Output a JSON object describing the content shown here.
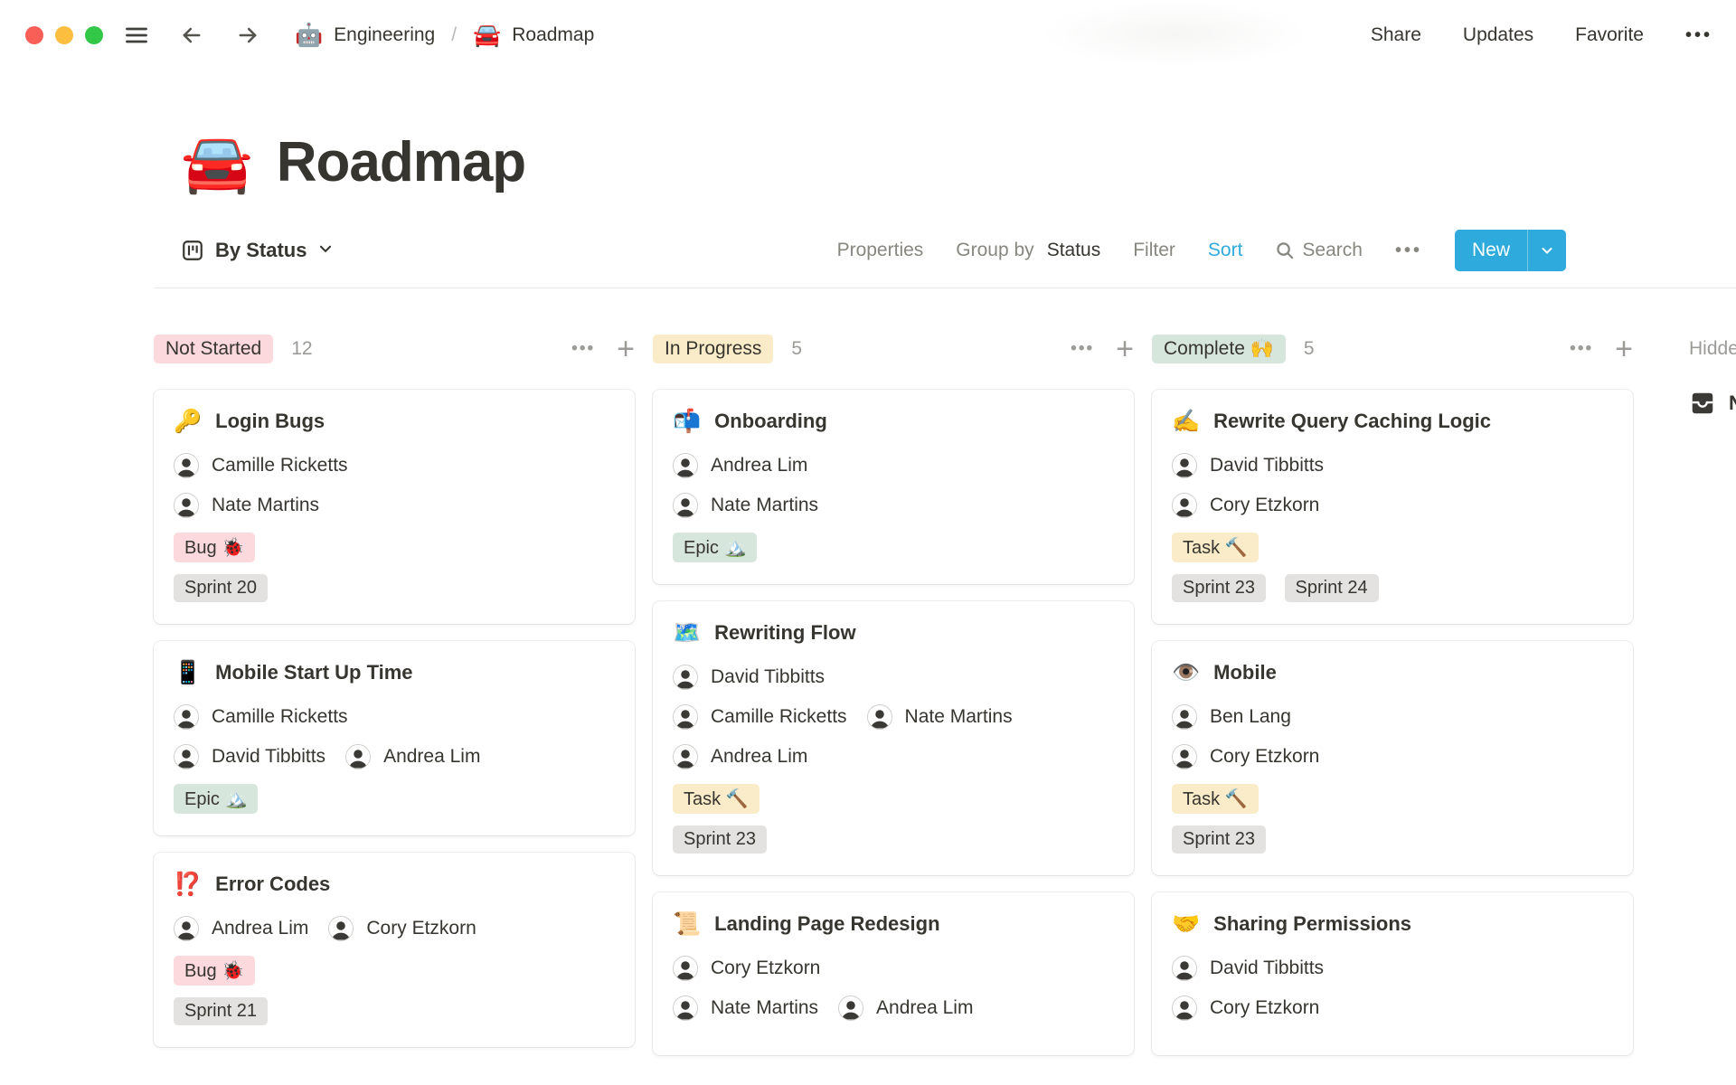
{
  "theme": {
    "accent_blue": "#2EAADC",
    "text_dark": "#37352F",
    "text_gray": "#9B9A97",
    "tag_pink": "#FBD9DC",
    "tag_yellow": "#FAEBC9",
    "tag_green": "#D7E6DD",
    "tag_gray": "#E3E2E0",
    "traffic_red": "#F95F57",
    "traffic_yellow": "#FBBE3F",
    "traffic_green": "#33C748"
  },
  "topbar": {
    "breadcrumb": {
      "space_icon": "🤖",
      "space_label": "Engineering",
      "separator": "/",
      "page_icon": "🚘",
      "page_label": "Roadmap"
    },
    "actions": {
      "share": "Share",
      "updates": "Updates",
      "favorite": "Favorite",
      "more": "•••"
    }
  },
  "page": {
    "icon": "🚘",
    "title": "Roadmap"
  },
  "toolbar": {
    "view_label": "By Status",
    "properties": "Properties",
    "group_by": "Group by",
    "group_by_value": "Status",
    "filter": "Filter",
    "sort": "Sort",
    "search": "Search",
    "more": "•••",
    "new_label": "New"
  },
  "board": {
    "hidden_label": "Hidden",
    "no_status_label": "No",
    "columns": [
      {
        "name": "Not Started",
        "count": "12",
        "more": "•••",
        "add": "+",
        "cards": [
          {
            "icon": "🔑",
            "title": "Login Bugs",
            "people": [
              [
                "Camille Ricketts"
              ],
              [
                "Nate Martins"
              ]
            ],
            "tags": [
              [
                {
                  "label": "Bug 🐞",
                  "color": "pink"
                }
              ],
              [
                {
                  "label": "Sprint 20",
                  "color": "gray"
                }
              ]
            ]
          },
          {
            "icon": "📱",
            "title": "Mobile Start Up Time",
            "people": [
              [
                "Camille Ricketts"
              ],
              [
                "David Tibbitts",
                "Andrea Lim"
              ]
            ],
            "tags": [
              [
                {
                  "label": "Epic 🏔️",
                  "color": "green"
                }
              ]
            ]
          },
          {
            "icon": "⁉️",
            "title": "Error Codes",
            "people": [
              [
                "Andrea Lim",
                "Cory Etzkorn"
              ]
            ],
            "tags": [
              [
                {
                  "label": "Bug 🐞",
                  "color": "pink"
                }
              ],
              [
                {
                  "label": "Sprint 21",
                  "color": "gray"
                }
              ]
            ]
          }
        ]
      },
      {
        "name": "In Progress",
        "count": "5",
        "more": "•••",
        "add": "+",
        "cards": [
          {
            "icon": "📬",
            "title": "Onboarding",
            "people": [
              [
                "Andrea Lim"
              ],
              [
                "Nate Martins"
              ]
            ],
            "tags": [
              [
                {
                  "label": "Epic 🏔️",
                  "color": "green"
                }
              ]
            ]
          },
          {
            "icon": "🗺️",
            "title": "Rewriting Flow",
            "people": [
              [
                "David Tibbitts"
              ],
              [
                "Camille Ricketts",
                "Nate Martins"
              ],
              [
                "Andrea Lim"
              ]
            ],
            "tags": [
              [
                {
                  "label": "Task 🔨",
                  "color": "yellow"
                }
              ],
              [
                {
                  "label": "Sprint 23",
                  "color": "gray"
                }
              ]
            ]
          },
          {
            "icon": "📜",
            "title": "Landing Page Redesign",
            "people": [
              [
                "Cory Etzkorn"
              ],
              [
                "Nate Martins",
                "Andrea Lim"
              ]
            ],
            "tags": []
          }
        ]
      },
      {
        "name": "Complete 🙌",
        "count": "5",
        "more": "•••",
        "add": "+",
        "cards": [
          {
            "icon": "✍️",
            "title": "Rewrite Query Caching Logic",
            "people": [
              [
                "David Tibbitts"
              ],
              [
                "Cory Etzkorn"
              ]
            ],
            "tags": [
              [
                {
                  "label": "Task 🔨",
                  "color": "yellow"
                }
              ],
              [
                {
                  "label": "Sprint 23",
                  "color": "gray"
                },
                {
                  "label": "Sprint 24",
                  "color": "gray"
                }
              ]
            ]
          },
          {
            "icon": "👁️",
            "title": "Mobile",
            "people": [
              [
                "Ben Lang"
              ],
              [
                "Cory Etzkorn"
              ]
            ],
            "tags": [
              [
                {
                  "label": "Task 🔨",
                  "color": "yellow"
                }
              ],
              [
                {
                  "label": "Sprint 23",
                  "color": "gray"
                }
              ]
            ]
          },
          {
            "icon": "🤝",
            "title": "Sharing Permissions",
            "people": [
              [
                "David Tibbitts"
              ],
              [
                "Cory Etzkorn"
              ]
            ],
            "tags": []
          }
        ]
      }
    ]
  }
}
